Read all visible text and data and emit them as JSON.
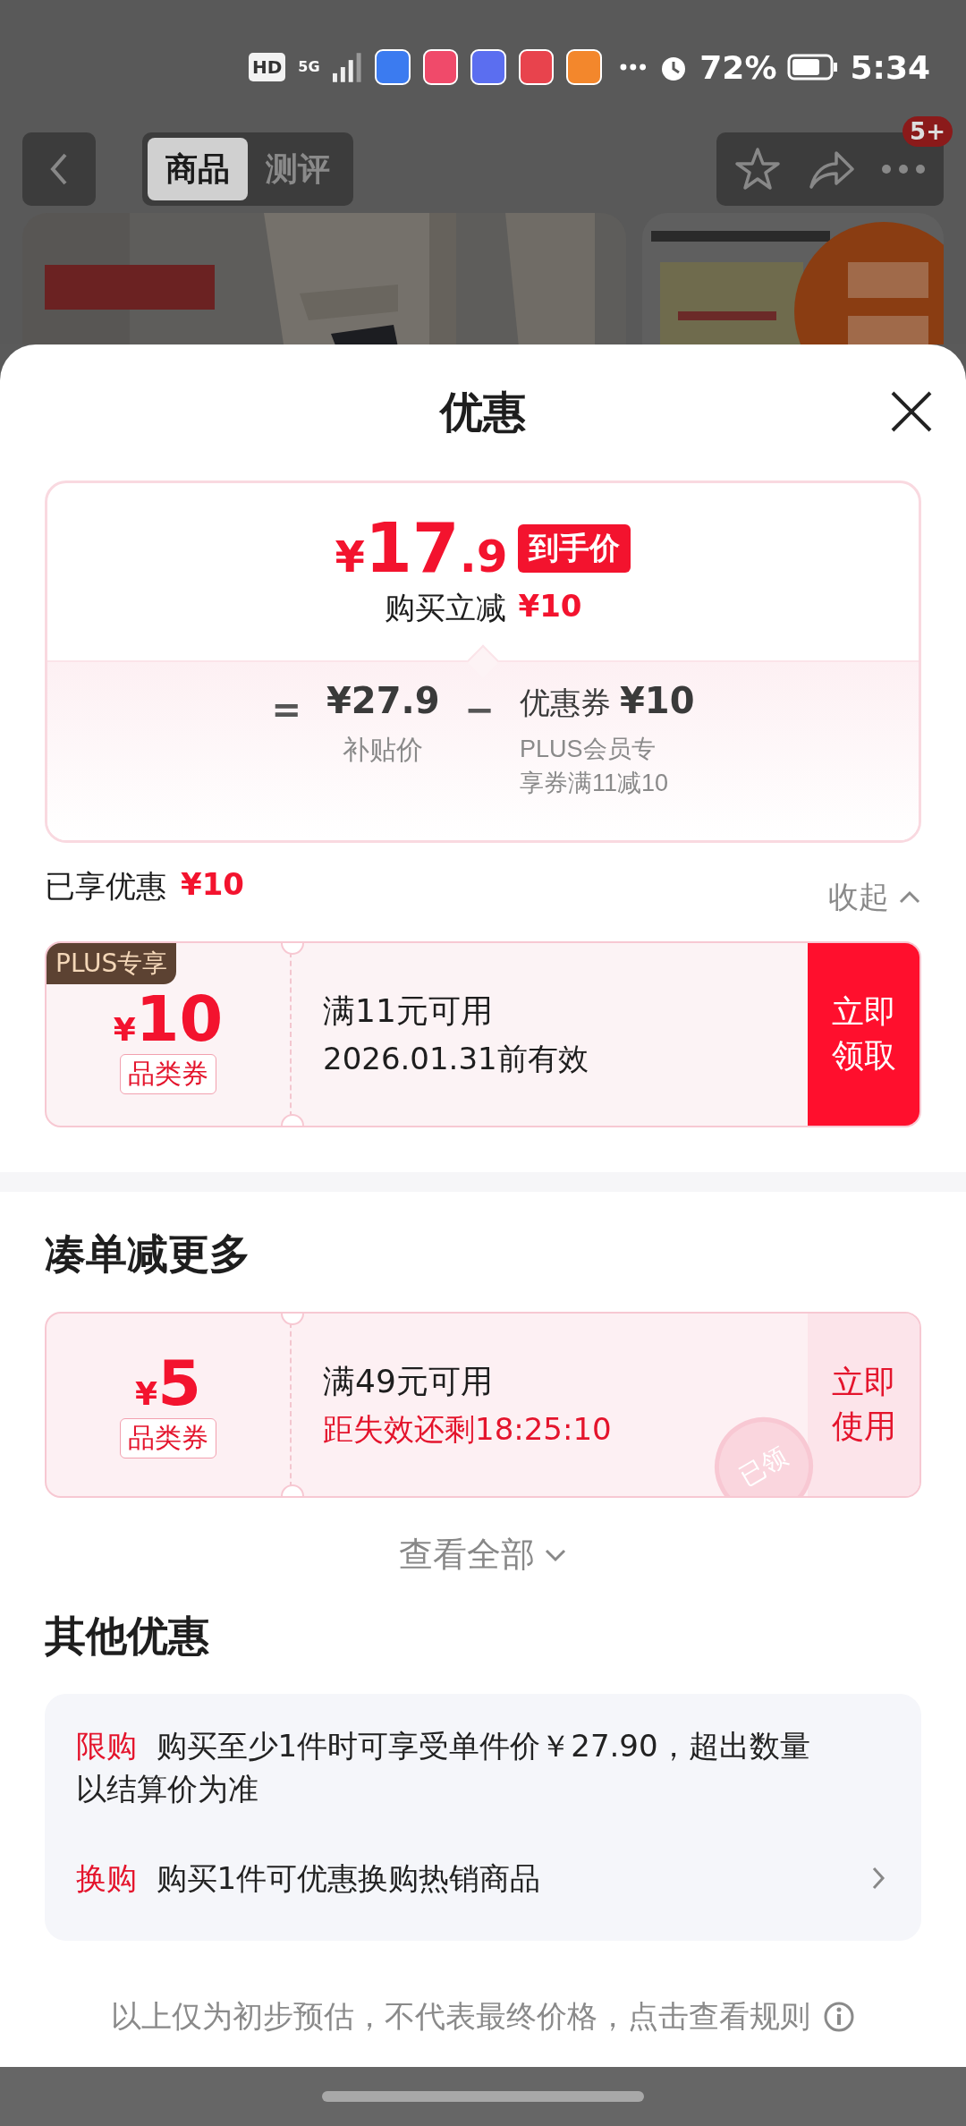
{
  "status_bar": {
    "hd": "HD",
    "network": "5G",
    "battery": "72%",
    "time": "5:34"
  },
  "nav": {
    "tabs": [
      {
        "label": "商品",
        "selected": true
      },
      {
        "label": "测评",
        "selected": false
      }
    ],
    "badge": "5+"
  },
  "sheet_title": "优惠",
  "price_card": {
    "currency": "¥",
    "price_int": "17",
    "price_dec": ".9",
    "price_tag": "到手价",
    "instant_label": "购买立减",
    "instant_amount": "¥10",
    "equals": "=",
    "base_price": "¥27.9",
    "base_label": "补贴价",
    "minus": "−",
    "coupon_label": "优惠券",
    "coupon_amount": "¥10",
    "coupon_desc": "PLUS会员专享券满11减10"
  },
  "enjoyed": {
    "label": "已享优惠",
    "amount": "¥10"
  },
  "collapse_label": "收起",
  "coupons": [
    {
      "badge": "PLUS专享",
      "currency": "¥",
      "amount": "10",
      "type": "品类券",
      "condition": "满11元可用",
      "validity": "2026.01.31前有效",
      "action": "立即领取",
      "claimed": false
    }
  ],
  "more_title": "凑单减更多",
  "more_coupons": [
    {
      "currency": "¥",
      "amount": "5",
      "type": "品类券",
      "condition": "满49元可用",
      "validity": "距失效还剩18:25:10",
      "action": "立即使用",
      "claimed": true,
      "stamp": "已领"
    }
  ],
  "view_all": "查看全部",
  "other_title": "其他优惠",
  "other_offers": [
    {
      "tag": "限购",
      "text": "购买至少1件时可享受单件价￥27.90，超出数量以结算价为准"
    },
    {
      "tag": "换购",
      "text": "购买1件可优惠换购热销商品",
      "has_arrow": true
    }
  ],
  "disclaimer": "以上仅为初步预估，不代表最终价格，点击查看规则"
}
